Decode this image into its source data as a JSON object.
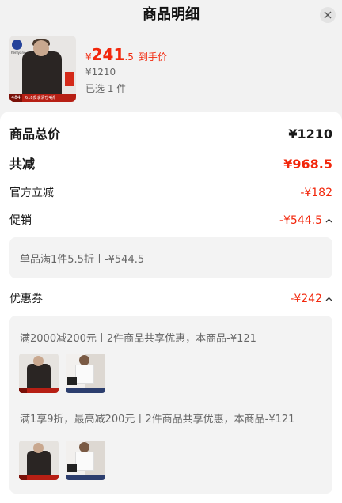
{
  "header": {
    "title": "商品明细"
  },
  "product": {
    "brand": "henlyane",
    "badge_price": "484",
    "promo": "618反季清仓4折",
    "deal_price_currency": "¥",
    "deal_price_int": "241",
    "deal_price_dec": ".5",
    "deal_price_label": "到手价",
    "original_price": "¥1210",
    "selected_count": "已选 1 件"
  },
  "summary": {
    "total_label": "商品总价",
    "total_value": "¥1210",
    "discount_label": "共减",
    "discount_value": "¥968.5",
    "official_label": "官方立减",
    "official_value": "-¥182",
    "promo_label": "促销",
    "promo_value": "-¥544.5",
    "promo_detail": "单品满1件5.5折丨-¥544.5",
    "coupon_label": "优惠券",
    "coupon_value": "-¥242",
    "coupon_1": "满2000减200元丨2件商品共享优惠，本商品-¥121",
    "coupon_2": "满1享9折，最高减200元丨2件商品共享优惠，本商品-¥121"
  },
  "colors": {
    "accent": "#f2270c",
    "background": "#f2f2f2",
    "box": "#f3f3f3"
  }
}
